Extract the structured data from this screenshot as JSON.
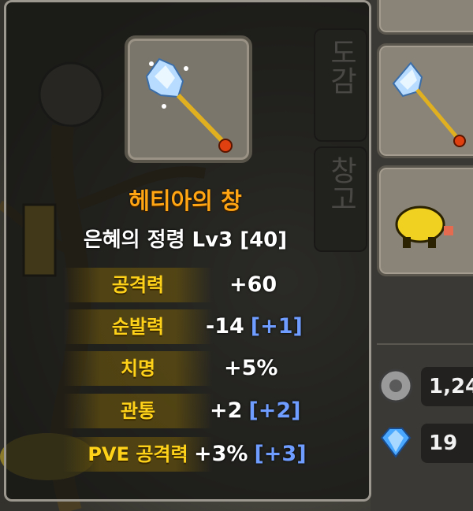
{
  "tooltip": {
    "item_name": "헤티아의 창",
    "enchant_line": "은혜의 정령 Lv3 [40]",
    "stats": [
      {
        "label": "공격력",
        "value": "+60",
        "bonus": ""
      },
      {
        "label": "순발력",
        "value": "-14",
        "bonus": "[+1]"
      },
      {
        "label": "치명",
        "value": "+5%",
        "bonus": ""
      },
      {
        "label": "관통",
        "value": "+2",
        "bonus": "[+2]"
      },
      {
        "label": "PVE 공격력",
        "value": "+3%",
        "bonus": "[+3]"
      }
    ]
  },
  "tabs": {
    "collection": "도감",
    "storage": "창고"
  },
  "currency": {
    "gear_amount": "1,24",
    "gem_amount": "19"
  },
  "colors": {
    "item_name": "#ffa514",
    "stat_label": "#ffd21a",
    "bonus": "#6f9cff"
  }
}
